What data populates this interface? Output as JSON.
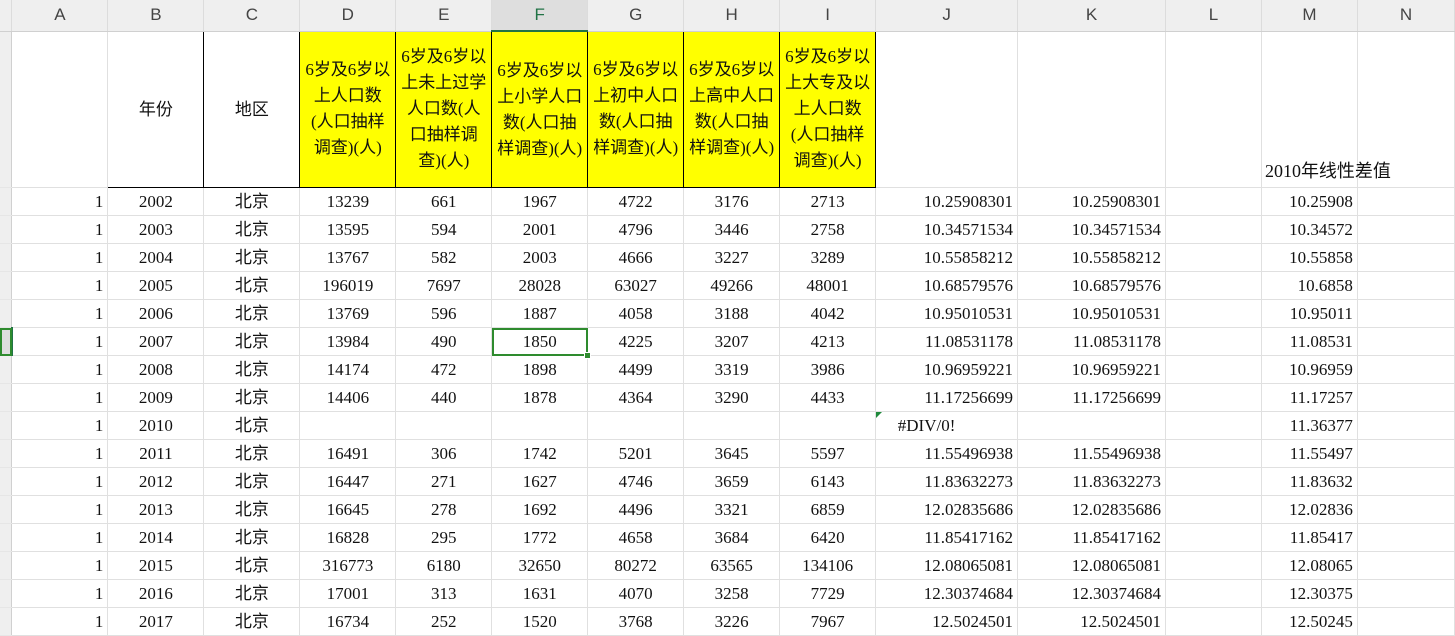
{
  "columns": [
    "A",
    "B",
    "C",
    "D",
    "E",
    "F",
    "G",
    "H",
    "I",
    "J",
    "K",
    "L",
    "M",
    "N"
  ],
  "selected_column": "F",
  "header_row": {
    "year": "年份",
    "region": "地区",
    "d": "6岁及6岁以上人口数(人口抽样调查)(人)",
    "e": "6岁及6岁以上未上过学人口数(人口抽样调查)(人)",
    "f": "6岁及6岁以上小学人口数(人口抽样调查)(人)",
    "g": "6岁及6岁以上初中人口数(人口抽样调查)(人)",
    "h": "6岁及6岁以上高中人口数(人口抽样调查)(人)",
    "i": "6岁及6岁以上大专及以上人口数(人口抽样调查)(人)",
    "m": "2010年线性差值"
  },
  "rows": [
    {
      "a": "1",
      "year": "2002",
      "region": "北京",
      "d": "13239",
      "e": "661",
      "f": "1967",
      "g": "4722",
      "h": "3176",
      "i": "2713",
      "j": "10.25908301",
      "k": "10.25908301",
      "m": "10.25908"
    },
    {
      "a": "1",
      "year": "2003",
      "region": "北京",
      "d": "13595",
      "e": "594",
      "f": "2001",
      "g": "4796",
      "h": "3446",
      "i": "2758",
      "j": "10.34571534",
      "k": "10.34571534",
      "m": "10.34572"
    },
    {
      "a": "1",
      "year": "2004",
      "region": "北京",
      "d": "13767",
      "e": "582",
      "f": "2003",
      "g": "4666",
      "h": "3227",
      "i": "3289",
      "j": "10.55858212",
      "k": "10.55858212",
      "m": "10.55858"
    },
    {
      "a": "1",
      "year": "2005",
      "region": "北京",
      "d": "196019",
      "e": "7697",
      "f": "28028",
      "g": "63027",
      "h": "49266",
      "i": "48001",
      "j": "10.68579576",
      "k": "10.68579576",
      "m": "10.6858"
    },
    {
      "a": "1",
      "year": "2006",
      "region": "北京",
      "d": "13769",
      "e": "596",
      "f": "1887",
      "g": "4058",
      "h": "3188",
      "i": "4042",
      "j": "10.95010531",
      "k": "10.95010531",
      "m": "10.95011"
    },
    {
      "a": "1",
      "year": "2007",
      "region": "北京",
      "d": "13984",
      "e": "490",
      "f": "1850",
      "g": "4225",
      "h": "3207",
      "i": "4213",
      "j": "11.08531178",
      "k": "11.08531178",
      "m": "11.08531"
    },
    {
      "a": "1",
      "year": "2008",
      "region": "北京",
      "d": "14174",
      "e": "472",
      "f": "1898",
      "g": "4499",
      "h": "3319",
      "i": "3986",
      "j": "10.96959221",
      "k": "10.96959221",
      "m": "10.96959"
    },
    {
      "a": "1",
      "year": "2009",
      "region": "北京",
      "d": "14406",
      "e": "440",
      "f": "1878",
      "g": "4364",
      "h": "3290",
      "i": "4433",
      "j": "11.17256699",
      "k": "11.17256699",
      "m": "11.17257"
    },
    {
      "a": "1",
      "year": "2010",
      "region": "北京",
      "d": "",
      "e": "",
      "f": "",
      "g": "",
      "h": "",
      "i": "",
      "j": "#DIV/0!",
      "k": "",
      "m": "11.36377"
    },
    {
      "a": "1",
      "year": "2011",
      "region": "北京",
      "d": "16491",
      "e": "306",
      "f": "1742",
      "g": "5201",
      "h": "3645",
      "i": "5597",
      "j": "11.55496938",
      "k": "11.55496938",
      "m": "11.55497"
    },
    {
      "a": "1",
      "year": "2012",
      "region": "北京",
      "d": "16447",
      "e": "271",
      "f": "1627",
      "g": "4746",
      "h": "3659",
      "i": "6143",
      "j": "11.83632273",
      "k": "11.83632273",
      "m": "11.83632"
    },
    {
      "a": "1",
      "year": "2013",
      "region": "北京",
      "d": "16645",
      "e": "278",
      "f": "1692",
      "g": "4496",
      "h": "3321",
      "i": "6859",
      "j": "12.02835686",
      "k": "12.02835686",
      "m": "12.02836"
    },
    {
      "a": "1",
      "year": "2014",
      "region": "北京",
      "d": "16828",
      "e": "295",
      "f": "1772",
      "g": "4658",
      "h": "3684",
      "i": "6420",
      "j": "11.85417162",
      "k": "11.85417162",
      "m": "11.85417"
    },
    {
      "a": "1",
      "year": "2015",
      "region": "北京",
      "d": "316773",
      "e": "6180",
      "f": "32650",
      "g": "80272",
      "h": "63565",
      "i": "134106",
      "j": "12.08065081",
      "k": "12.08065081",
      "m": "12.08065"
    },
    {
      "a": "1",
      "year": "2016",
      "region": "北京",
      "d": "17001",
      "e": "313",
      "f": "1631",
      "g": "4070",
      "h": "3258",
      "i": "7729",
      "j": "12.30374684",
      "k": "12.30374684",
      "m": "12.30375"
    },
    {
      "a": "1",
      "year": "2017",
      "region": "北京",
      "d": "16734",
      "e": "252",
      "f": "1520",
      "g": "3768",
      "h": "3226",
      "i": "7967",
      "j": "12.5024501",
      "k": "12.5024501",
      "m": "12.50245"
    }
  ],
  "colors": {
    "header_fill": "#ffff00",
    "selection": "#217346"
  }
}
